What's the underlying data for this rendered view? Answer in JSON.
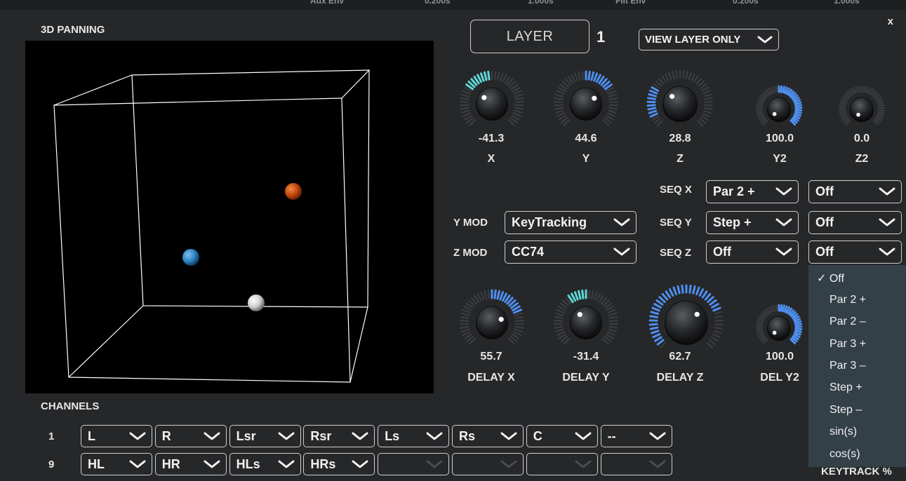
{
  "top_strip": [
    "Aux Env",
    "0.200s",
    "1.000s",
    "Filt Env",
    "0.200s",
    "1.000s"
  ],
  "panning": {
    "title": "3D PANNING",
    "close_label": "x"
  },
  "layer": {
    "label": "LAYER",
    "number": "1",
    "view_mode": "VIEW LAYER ONLY"
  },
  "knobs_top": [
    {
      "value": "-41.3",
      "label": "X"
    },
    {
      "value": "44.6",
      "label": "Y"
    },
    {
      "value": "28.8",
      "label": "Z"
    },
    {
      "value": "100.0",
      "label": "Y2"
    },
    {
      "value": "0.0",
      "label": "Z2"
    }
  ],
  "knobs_bottom": [
    {
      "value": "55.7",
      "label": "DELAY X"
    },
    {
      "value": "-31.4",
      "label": "DELAY Y"
    },
    {
      "value": "62.7",
      "label": "DELAY Z"
    },
    {
      "value": "100.0",
      "label": "DEL Y2"
    }
  ],
  "mods": {
    "y_label": "Y MOD",
    "y_value": "KeyTracking",
    "z_label": "Z MOD",
    "z_value": "CC74"
  },
  "seq": {
    "x_label": "SEQ X",
    "x_value": "Par 2 +",
    "x_value2": "Off",
    "y_label": "SEQ Y",
    "y_value": "Step +",
    "y_value2": "Off",
    "z_label": "SEQ Z",
    "z_value": "Off",
    "z_value2": "Off"
  },
  "menu": {
    "check": "✓",
    "items": [
      "Off",
      "Par 2 +",
      "Par 2 –",
      "Par 3 +",
      "Par 3 –",
      "Step +",
      "Step –",
      "sin(s)",
      "cos(s)"
    ],
    "selected": "Off"
  },
  "channels": {
    "title": "CHANNELS",
    "row1_num": "1",
    "row1": [
      "L",
      "R",
      "Lsr",
      "Rsr",
      "Ls",
      "Rs",
      "C",
      "--"
    ],
    "row2_num": "9",
    "row2": [
      "HL",
      "HR",
      "HLs",
      "HRs",
      "",
      "",
      "",
      ""
    ]
  },
  "keytrack_label": "KEYTRACK %",
  "colors": {
    "accent_teal": "#5fd6d6",
    "accent_blue": "#4f8ff0",
    "sphere_orange": "#c8480f",
    "sphere_blue": "#2e86c7",
    "sphere_white": "#d8d8d8",
    "menu_bg": "#344048"
  },
  "icons": {
    "dropdown": "chevron-down-icon",
    "close": "close-icon",
    "check": "check-icon"
  }
}
